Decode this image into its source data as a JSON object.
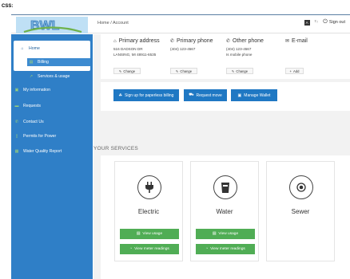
{
  "label": "CSS:",
  "header": {
    "breadcrumb": "Home / Account",
    "lang_icon": "A",
    "sign_out": "Sign out"
  },
  "sidebar": {
    "items": [
      {
        "label": "Home",
        "icon": "home-icon"
      },
      {
        "label": "Billing",
        "icon": "billing-icon"
      },
      {
        "label": "Services & usage",
        "icon": "chart-line-icon"
      },
      {
        "label": "My information",
        "icon": "id-card-icon"
      },
      {
        "label": "Requests",
        "icon": "chat-icon"
      },
      {
        "label": "Contact Us",
        "icon": "phone-icon"
      },
      {
        "label": "Permits for Power",
        "icon": "document-icon"
      },
      {
        "label": "Water Quality Report",
        "icon": "grid-icon"
      }
    ]
  },
  "contact": {
    "primary_address": {
      "heading": "Primary address",
      "line1": "516 DADSON DR",
      "line2": "LANSING, MI 48911-6535",
      "button": "Change"
    },
    "primary_phone": {
      "heading": "Primary phone",
      "line1": "(404) 123-4567",
      "button": "Change"
    },
    "other_phone": {
      "heading": "Other phone",
      "line1": "(404) 123-4567",
      "line2": "Is mobile phone",
      "button": "Change"
    },
    "email": {
      "heading": "E-mail",
      "button": "Add"
    }
  },
  "actions": {
    "paperless": "Sign up for paperless billing",
    "move": "Request move",
    "wallet": "Manage Wallet"
  },
  "services_title": "YOUR SERVICES",
  "services": [
    {
      "name": "Electric",
      "icon": "plug-icon",
      "view_usage": "View usage",
      "meter": "View meter readings"
    },
    {
      "name": "Water",
      "icon": "water-icon",
      "view_usage": "View usage",
      "meter": "View meter readings"
    },
    {
      "name": "Sewer",
      "icon": "target-icon"
    }
  ],
  "colors": {
    "brand_blue": "#2f7fc7",
    "button_blue": "#1f78c3",
    "button_green": "#50ad55"
  }
}
